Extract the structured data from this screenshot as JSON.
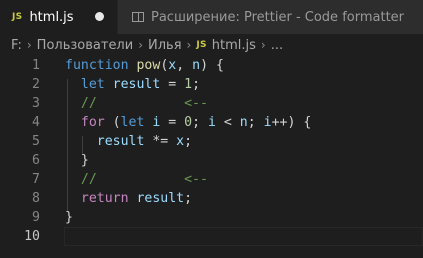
{
  "tabs": {
    "active": {
      "badge": "JS",
      "label": "html.js",
      "modified": true
    },
    "inactive": {
      "label": "Расширение: Prettier - Code formatter",
      "icon": "preview-icon"
    }
  },
  "breadcrumbs": {
    "items": [
      "F:",
      "Пользователи",
      "Илья",
      "html.js",
      "..."
    ],
    "separator": "›",
    "file_badge": "JS"
  },
  "editor": {
    "line_numbers": [
      "1",
      "2",
      "3",
      "4",
      "5",
      "6",
      "7",
      "8",
      "9",
      "10"
    ],
    "current_line": "10",
    "lines": [
      [
        [
          "k-blue",
          "function"
        ],
        [
          "op",
          " "
        ],
        [
          "fn",
          "pow"
        ],
        [
          "op",
          "("
        ],
        [
          "var",
          "x"
        ],
        [
          "op",
          ", "
        ],
        [
          "var",
          "n"
        ],
        [
          "op",
          ") {"
        ]
      ],
      [
        [
          "op",
          "  "
        ],
        [
          "k-blue",
          "let"
        ],
        [
          "op",
          " "
        ],
        [
          "var",
          "result"
        ],
        [
          "op",
          " = "
        ],
        [
          "num",
          "1"
        ],
        [
          "op",
          ";"
        ]
      ],
      [
        [
          "op",
          "  "
        ],
        [
          "cmt",
          "//           <--"
        ]
      ],
      [
        [
          "op",
          "  "
        ],
        [
          "k-purple",
          "for"
        ],
        [
          "op",
          " ("
        ],
        [
          "k-blue",
          "let"
        ],
        [
          "op",
          " "
        ],
        [
          "var",
          "i"
        ],
        [
          "op",
          " = "
        ],
        [
          "num",
          "0"
        ],
        [
          "op",
          "; "
        ],
        [
          "var",
          "i"
        ],
        [
          "op",
          " < "
        ],
        [
          "var",
          "n"
        ],
        [
          "op",
          "; "
        ],
        [
          "var",
          "i"
        ],
        [
          "op",
          "++) {"
        ]
      ],
      [
        [
          "op",
          "    "
        ],
        [
          "var",
          "result"
        ],
        [
          "op",
          " *= "
        ],
        [
          "var",
          "x"
        ],
        [
          "op",
          ";"
        ]
      ],
      [
        [
          "op",
          "  }"
        ]
      ],
      [
        [
          "op",
          "  "
        ],
        [
          "cmt",
          "//           <--"
        ]
      ],
      [
        [
          "op",
          "  "
        ],
        [
          "k-purple",
          "return"
        ],
        [
          "op",
          " "
        ],
        [
          "var",
          "result"
        ],
        [
          "op",
          ";"
        ]
      ],
      [
        [
          "op",
          "}"
        ]
      ],
      []
    ]
  },
  "colors": {
    "background": "#1e1e1e",
    "tab_bar": "#252526",
    "keyword": "#569cd6",
    "control_keyword": "#c586c0",
    "function": "#dcdcaa",
    "variable": "#9cdcfe",
    "number": "#b5cea8",
    "comment": "#6a9955",
    "js_badge": "#cbcb41"
  }
}
